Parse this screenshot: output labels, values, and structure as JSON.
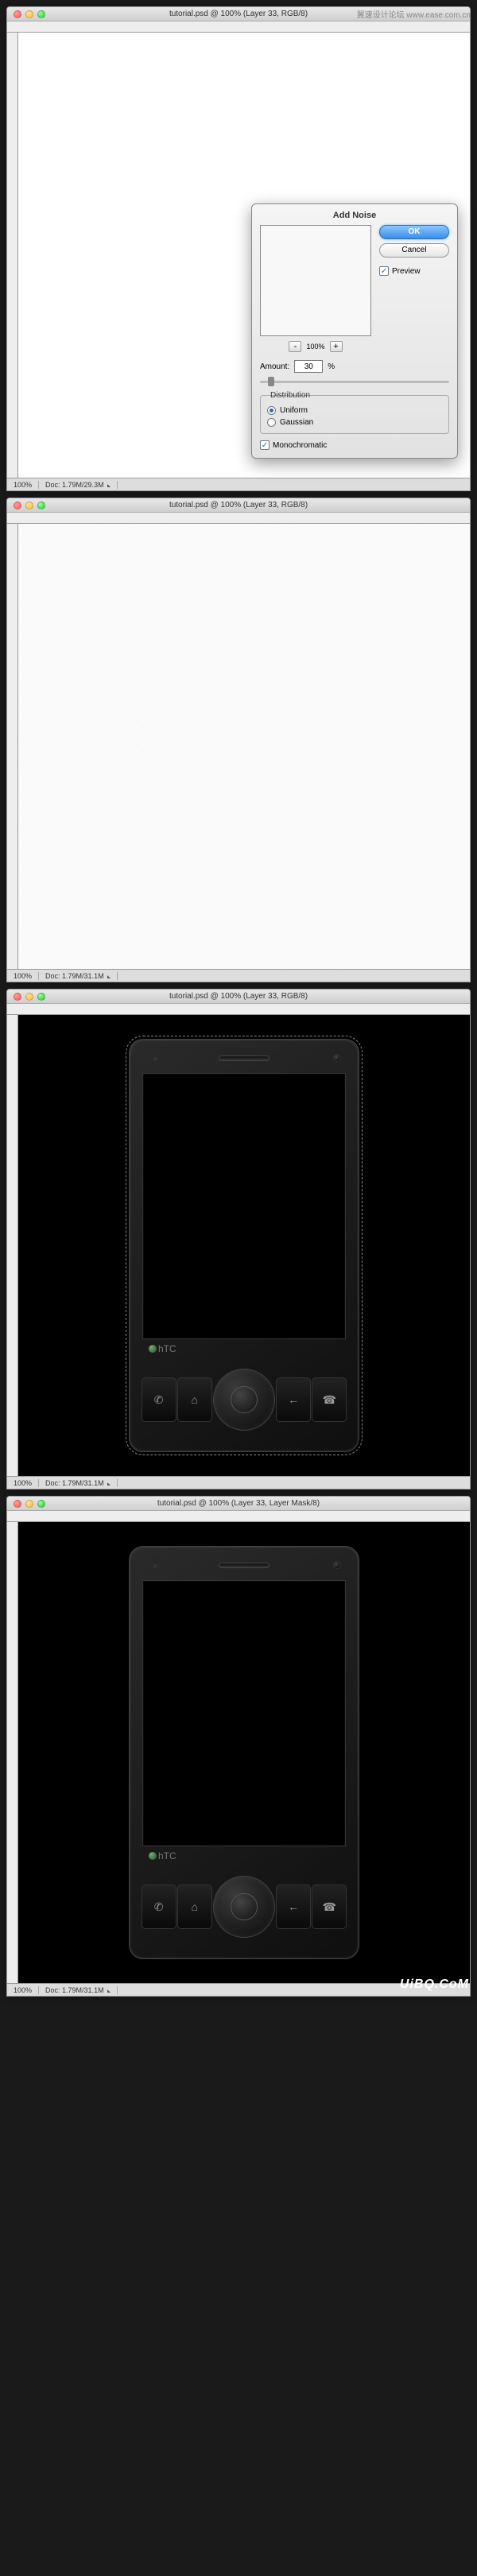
{
  "watermark_top": "翼速设计论坛 www.ease.com.cn",
  "watermark_bottom": "UiBQ.CoM",
  "traffic": {
    "close": "close",
    "min": "minimize",
    "zoom": "zoom"
  },
  "panels": [
    {
      "title": "tutorial.psd @ 100% (Layer 33, RGB/8)",
      "zoom": "100%",
      "doc_info": "Doc: 1.79M/29.3M",
      "noise_applied": false,
      "has_dialog": true,
      "is_phone": false
    },
    {
      "title": "tutorial.psd @ 100% (Layer 33, RGB/8)",
      "zoom": "100%",
      "doc_info": "Doc: 1.79M/31.1M",
      "noise_applied": true,
      "has_dialog": false,
      "is_phone": false
    },
    {
      "title": "tutorial.psd @ 100% (Layer 33, RGB/8)",
      "zoom": "100%",
      "doc_info": "Doc: 1.79M/31.1M",
      "noise_applied": false,
      "has_dialog": false,
      "is_phone": true,
      "phone_selected": true
    },
    {
      "title": "tutorial.psd @ 100% (Layer 33, Layer Mask/8)",
      "zoom": "100%",
      "doc_info": "Doc: 1.79M/31.1M",
      "noise_applied": false,
      "has_dialog": false,
      "is_phone": true,
      "phone_selected": false
    }
  ],
  "dialog": {
    "title": "Add Noise",
    "ok": "OK",
    "cancel": "Cancel",
    "preview_label": "Preview",
    "preview_checked": true,
    "zoom_out": "-",
    "zoom_in": "+",
    "zoom_value": "100%",
    "amount_label": "Amount:",
    "amount_value": "30",
    "amount_unit": "%",
    "distribution_label": "Distribution",
    "uniform": "Uniform",
    "gaussian": "Gaussian",
    "distribution_selected": "uniform",
    "mono_label": "Monochromatic",
    "mono_checked": true
  },
  "phone": {
    "brand": "hTC",
    "btn_home": "⌂",
    "btn_call": "✆",
    "btn_end": "☎",
    "btn_back": "←"
  }
}
